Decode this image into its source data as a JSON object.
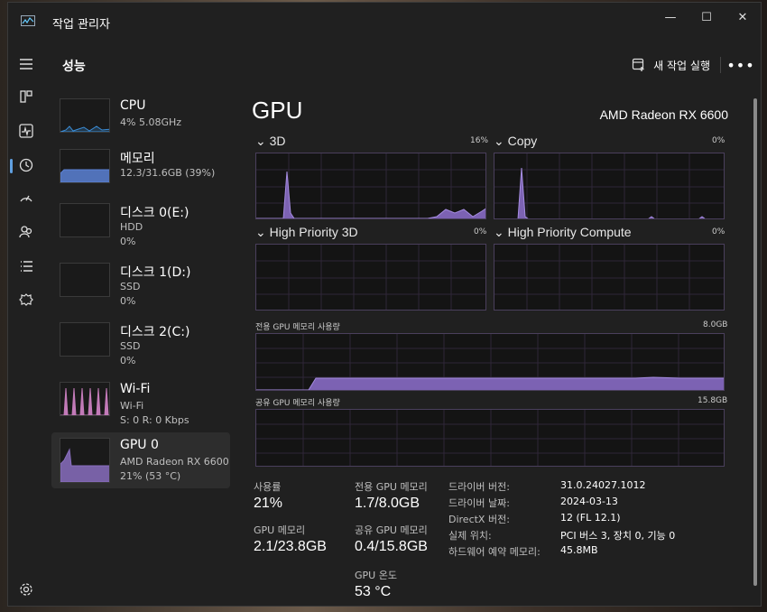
{
  "window": {
    "title": "작업 관리자"
  },
  "header": {
    "page_title": "성능",
    "run_task_label": "새 작업 실행",
    "more_label": "•••"
  },
  "colors": {
    "purple": "#8a6fc0",
    "fill": "#7c62b3",
    "blue": "#5c82d6",
    "pink": "#c27ab8",
    "bg": "#202020"
  },
  "resources": [
    {
      "name": "CPU",
      "line1": "4%  5.08GHz",
      "line2": "",
      "color": "#3b8ed8"
    },
    {
      "name": "메모리",
      "line1": "12.3/31.6GB (39%)",
      "line2": "",
      "color": "#5c82d6"
    },
    {
      "name": "디스크 0(E:)",
      "line1": "HDD",
      "line2": "0%",
      "color": "#6aa84f"
    },
    {
      "name": "디스크 1(D:)",
      "line1": "SSD",
      "line2": "0%",
      "color": "#6aa84f"
    },
    {
      "name": "디스크 2(C:)",
      "line1": "SSD",
      "line2": "0%",
      "color": "#6aa84f"
    },
    {
      "name": "Wi-Fi",
      "line1": "Wi-Fi",
      "line2": "S: 0 R: 0 Kbps",
      "color": "#c27ab8"
    },
    {
      "name": "GPU 0",
      "line1": "AMD Radeon RX 6600",
      "line2": "21% (53 °C)",
      "color": "#8a6fc0"
    }
  ],
  "gpu": {
    "title": "GPU",
    "model": "AMD Radeon RX 6600",
    "engines": [
      {
        "label": "3D",
        "pct": "16%"
      },
      {
        "label": "Copy",
        "pct": "0%"
      },
      {
        "label": "High Priority 3D",
        "pct": "0%"
      },
      {
        "label": "High Priority Compute",
        "pct": "0%"
      }
    ],
    "dedicated": {
      "label": "전용 GPU 메모리 사용량",
      "max": "8.0GB"
    },
    "shared": {
      "label": "공유 GPU 메모리 사용량",
      "max": "15.8GB"
    },
    "stats": {
      "utilization_label": "사용률",
      "utilization": "21%",
      "gpu_mem_label": "GPU 메모리",
      "gpu_mem": "2.1/23.8GB",
      "dedicated_label": "전용 GPU 메모리",
      "dedicated": "1.7/8.0GB",
      "shared_label": "공유 GPU 메모리",
      "shared": "0.4/15.8GB",
      "temp_label": "GPU 온도",
      "temp": "53 °C"
    },
    "info": [
      {
        "k": "드라이버 버전:",
        "v": "31.0.24027.1012"
      },
      {
        "k": "드라이버 날짜:",
        "v": "2024-03-13"
      },
      {
        "k": "DirectX 버전:",
        "v": "12 (FL 12.1)"
      },
      {
        "k": "실제 위치:",
        "v": "PCI 버스 3, 장치 0, 기능 0"
      },
      {
        "k": "하드웨어 예약 메모리:",
        "v": "45.8MB"
      }
    ]
  }
}
